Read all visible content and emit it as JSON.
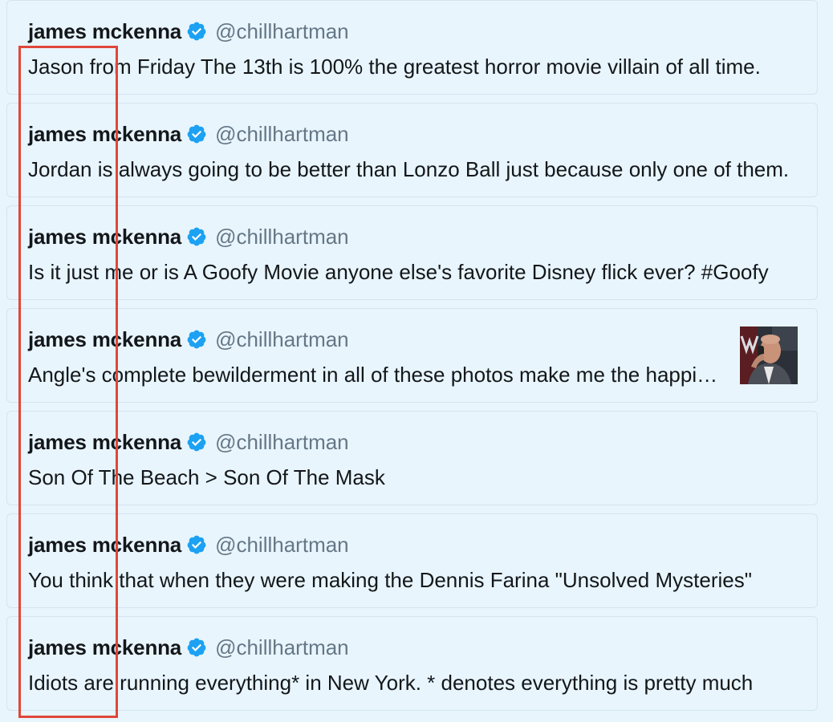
{
  "tweets": [
    {
      "display_name": "james mckenna",
      "handle": "@chillhartman",
      "text": "Jason from Friday The 13th is 100% the greatest horror movie villain of all time."
    },
    {
      "display_name": "james mckenna",
      "handle": "@chillhartman",
      "text": "Jordan is always going to be better than Lonzo Ball just because only one of them."
    },
    {
      "display_name": "james mckenna",
      "handle": "@chillhartman",
      "text": "Is it just me or is A Goofy Movie anyone else's favorite Disney flick ever? #Goofy"
    },
    {
      "display_name": "james mckenna",
      "handle": "@chillhartman",
      "text": "Angle's complete bewilderment in all of these photos make me the happiest."
    },
    {
      "display_name": "james mckenna",
      "handle": "@chillhartman",
      "text": "Son Of The Beach > Son Of The Mask"
    },
    {
      "display_name": "james mckenna",
      "handle": "@chillhartman",
      "text": "You think that when they were making the Dennis Farina \"Unsolved Mysteries\""
    },
    {
      "display_name": "james mckenna",
      "handle": "@chillhartman",
      "text": "Idiots are running everything* in New York. * denotes everything is pretty much"
    }
  ],
  "icons": {
    "verified": "verified-badge-icon",
    "media": "tweet-photo-thumbnail"
  },
  "colors": {
    "background": "#e8f5fd",
    "verified_blue": "#1da1f2",
    "handle_gray": "#657786",
    "text_dark": "#14171a",
    "highlight_red": "#e0473a"
  }
}
